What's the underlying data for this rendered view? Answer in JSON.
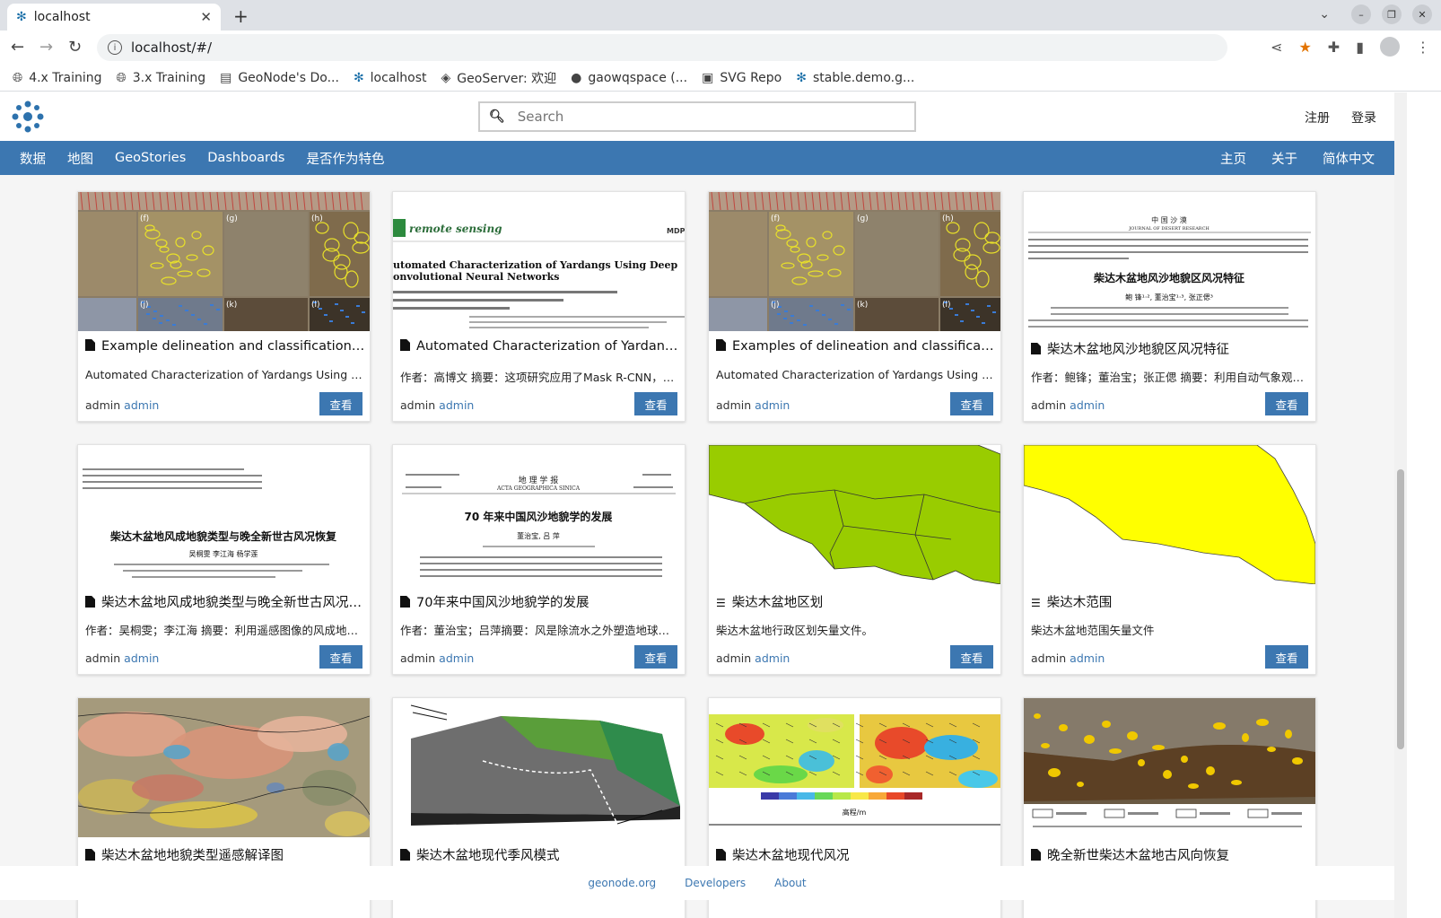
{
  "browser": {
    "tab_title": "localhost",
    "url": "localhost/#/",
    "bookmarks": [
      {
        "label": "4.x Training",
        "icon": "globe-icon"
      },
      {
        "label": "3.x Training",
        "icon": "globe-icon"
      },
      {
        "label": "GeoNode's Do...",
        "icon": "doc-icon"
      },
      {
        "label": "localhost",
        "icon": "geonode-icon"
      },
      {
        "label": "GeoServer: 欢迎",
        "icon": "geoserver-icon"
      },
      {
        "label": "gaowqspace (...",
        "icon": "github-icon"
      },
      {
        "label": "SVG Repo",
        "icon": "svgrepo-icon"
      },
      {
        "label": "stable.demo.g...",
        "icon": "geonode-icon"
      }
    ]
  },
  "header": {
    "search_placeholder": "Search",
    "register": "注册",
    "login": "登录"
  },
  "menu": {
    "left": [
      "数据",
      "地图",
      "GeoStories",
      "Dashboards",
      "是否作为特色"
    ],
    "right": [
      "主页",
      "关于",
      "简体中文"
    ]
  },
  "view_label": "查看",
  "cards": [
    {
      "type": "doc",
      "title": "Example delineation and classification re...",
      "abstract": "Automated Characterization of Yardangs Using Dee...",
      "avatar_alt": "admin",
      "owner": "admin",
      "thumb": "yardang-photos"
    },
    {
      "type": "doc",
      "title": "Automated Characterization of Yardangs ...",
      "abstract": "作者：高博文 摘要：这项研究应用了Mask R-CNN，使用...",
      "avatar_alt": "admin",
      "owner": "admin",
      "thumb": "paper-en"
    },
    {
      "type": "doc",
      "title": "Examples of delineation and classificatio...",
      "abstract": "Automated Characterization of Yardangs Using Dee...",
      "avatar_alt": "admin",
      "owner": "admin",
      "thumb": "yardang-photos"
    },
    {
      "type": "doc",
      "title": "柴达木盆地风沙地貌区风况特征",
      "abstract": "作者：鲍锋；董治宝；张正偲 摘要：利用自动气象观测仪...",
      "avatar_alt": "admin",
      "owner": "admin",
      "thumb": "paper-cn1"
    },
    {
      "type": "doc",
      "title": "柴达木盆地风成地貌类型与晚全新世古风况恢复",
      "abstract": "作者：吴桐雯；李江海 摘要：利用遥感图像的风成地貌形...",
      "avatar_alt": "admin",
      "owner": "admin",
      "thumb": "paper-cn2"
    },
    {
      "type": "doc",
      "title": "70年来中国风沙地貌学的发展",
      "abstract": "作者：董治宝；吕萍摘要：风是除流水之外塑造地球景观...",
      "avatar_alt": "admin",
      "owner": "admin",
      "thumb": "paper-cn3"
    },
    {
      "type": "dataset",
      "title": "柴达木盆地区划",
      "abstract": "柴达木盆地行政区划矢量文件。",
      "avatar_alt": "admin",
      "owner": "admin",
      "thumb": "green-map"
    },
    {
      "type": "dataset",
      "title": "柴达木范围",
      "abstract": "柴达木盆地范围矢量文件",
      "avatar_alt": "admin",
      "owner": "admin",
      "thumb": "yellow-map"
    },
    {
      "type": "doc",
      "title": "柴达木盆地地貌类型遥感解译图",
      "abstract": "",
      "avatar_alt": "",
      "owner": "",
      "thumb": "terrain-map"
    },
    {
      "type": "doc",
      "title": "柴达木盆地现代季风模式",
      "abstract": "",
      "avatar_alt": "",
      "owner": "",
      "thumb": "3d-block"
    },
    {
      "type": "doc",
      "title": "柴达木盆地现代风况",
      "abstract": "",
      "avatar_alt": "",
      "owner": "",
      "thumb": "wind-map"
    },
    {
      "type": "doc",
      "title": "晚全新世柴达木盆地古风向恢复",
      "abstract": "",
      "avatar_alt": "",
      "owner": "",
      "thumb": "dune-map"
    }
  ],
  "thumb_text": {
    "journal": "remote sensing",
    "mdpi": "MDPI",
    "paper_en_title1": "utomated Characterization of Yardangs Using Deep",
    "paper_en_title2": "onvolutional Neural Networks",
    "paper_cn1_head": "中 国 沙 漠",
    "paper_cn1_sub": "JOURNAL OF DESERT RESEARCH",
    "paper_cn1_title": "柴达木盆地风沙地貌区风况特征",
    "paper_cn1_authors": "鲍 锋¹·², 董治宝¹·³, 张正偲³",
    "paper_cn2_title": "柴达木盆地风成地貌类型与晚全新世古风况恢复",
    "paper_cn2_authors": "吴桐雯   李江海   杨学莲",
    "paper_cn3_journal": "地 理 学 报",
    "paper_cn3_journal_en": "ACTA GEOGRAPHICA SINICA",
    "paper_cn3_title": "70 年来中国风沙地貌学的发展",
    "paper_cn3_authors": "董治宝, 吕 萍",
    "legend_axis": "高程/m"
  },
  "footer": [
    "geonode.org",
    "Developers",
    "About"
  ]
}
